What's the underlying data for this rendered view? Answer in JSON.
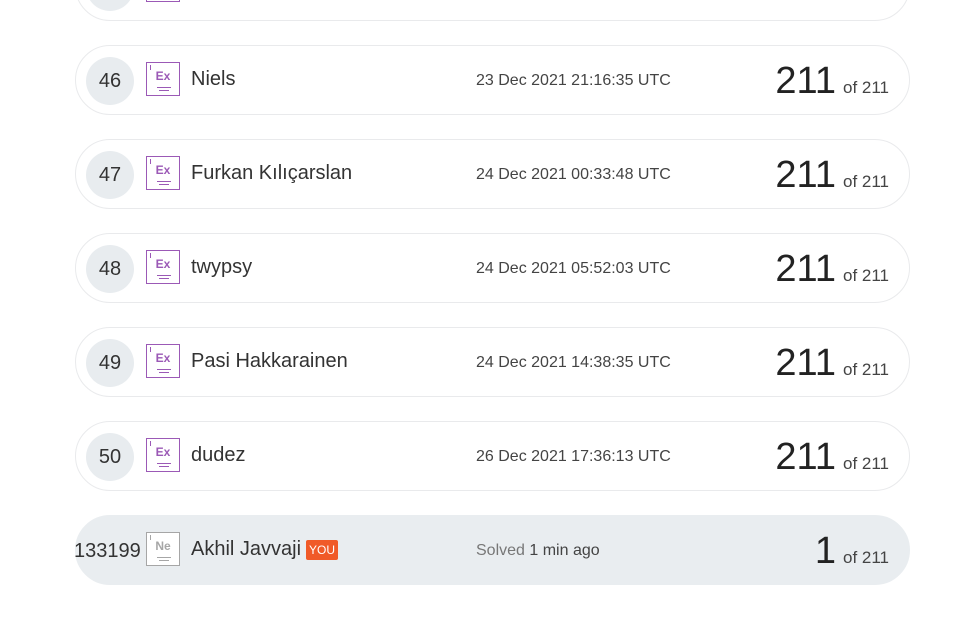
{
  "rows": [
    {
      "rank": "46",
      "badge": "Ex",
      "name": "Niels",
      "time": "23 Dec 2021 21:16:35 UTC",
      "score": "211",
      "of": "of 211"
    },
    {
      "rank": "47",
      "badge": "Ex",
      "name": "Furkan Kılıçarslan",
      "time": "24 Dec 2021 00:33:48 UTC",
      "score": "211",
      "of": "of 211"
    },
    {
      "rank": "48",
      "badge": "Ex",
      "name": "twypsy",
      "time": "24 Dec 2021 05:52:03 UTC",
      "score": "211",
      "of": "of 211"
    },
    {
      "rank": "49",
      "badge": "Ex",
      "name": "Pasi Hakkarainen",
      "time": "24 Dec 2021 14:38:35 UTC",
      "score": "211",
      "of": "of 211"
    },
    {
      "rank": "50",
      "badge": "Ex",
      "name": "dudez",
      "time": "26 Dec 2021 17:36:13 UTC",
      "score": "211",
      "of": "of 211"
    }
  ],
  "you_row": {
    "rank": "133199",
    "badge": "Ne",
    "name": "Akhil Javvaji",
    "you_label": "YOU",
    "solved_label": "Solved",
    "solved_time": "1 min ago",
    "score": "1",
    "of": "of 211"
  },
  "colors": {
    "badge_expert": "#9b59b6",
    "badge_newbie": "#a6a6a6",
    "you_tag": "#f05a28",
    "you_row_bg": "#e9edf0"
  },
  "icons": {
    "level_badge": "level-badge-icon"
  }
}
